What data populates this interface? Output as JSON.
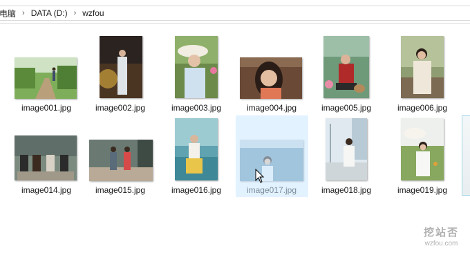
{
  "breadcrumb": {
    "items": [
      "电脑",
      "DATA (D:)",
      "wzfou"
    ],
    "separator": "›"
  },
  "files": [
    {
      "name": "image001.jpg",
      "selected": false
    },
    {
      "name": "image002.jpg",
      "selected": false
    },
    {
      "name": "image003.jpg",
      "selected": false
    },
    {
      "name": "image004.jpg",
      "selected": false
    },
    {
      "name": "image005.jpg",
      "selected": false
    },
    {
      "name": "image006.jpg",
      "selected": false
    },
    {
      "name": "image014.jpg",
      "selected": false
    },
    {
      "name": "image015.jpg",
      "selected": false
    },
    {
      "name": "image016.jpg",
      "selected": false
    },
    {
      "name": "image017.jpg",
      "selected": true
    },
    {
      "name": "image018.jpg",
      "selected": false
    },
    {
      "name": "image019.jpg",
      "selected": false
    }
  ],
  "watermark": {
    "text": "挖站否",
    "url": "wzfou.com"
  },
  "colors": {
    "selection": "#cce8ff",
    "border": "#d9d9d9"
  }
}
